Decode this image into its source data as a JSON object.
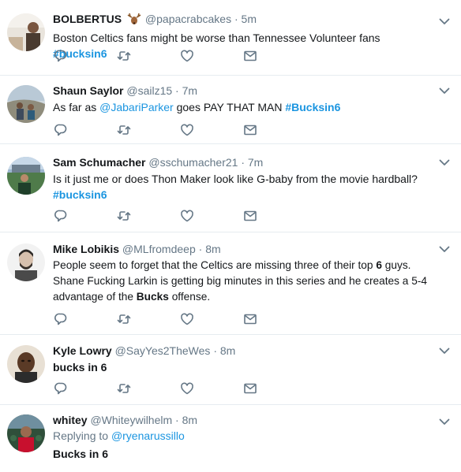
{
  "colors": {
    "link": "#1b95e0",
    "secondary_text": "#657786",
    "icon": "#657786",
    "divider": "#e6ecf0"
  },
  "icons": {
    "reply": "reply-icon",
    "retweet": "retweet-icon",
    "like": "heart-icon",
    "message": "envelope-icon",
    "menu": "chevron-down-icon"
  },
  "tweets": [
    {
      "name": "BOLBERTUS",
      "emoji": "deer-emoji",
      "handle": "@papacrabcakes",
      "dot": "·",
      "time": "5m",
      "text_before": "Boston Celtics fans might be worse than Tennessee Volunteer fans ",
      "hashtag": "#bucksin6"
    },
    {
      "name": "Shaun Saylor",
      "handle": "@sailz15",
      "dot": "·",
      "time": "7m",
      "text_before": "As far as ",
      "mention": "@JabariParker",
      "text_middle": " goes PAY THAT MAN ",
      "hashtag": "#Bucksin6"
    },
    {
      "name": "Sam Schumacher",
      "handle": "@sschumacher21",
      "dot": "·",
      "time": "7m",
      "text_before": "Is it just me or does Thon Maker look like G-baby from the movie hardball?",
      "hashtag": "#bucksin6"
    },
    {
      "name": "Mike Lobikis",
      "handle": "@MLfromdeep",
      "dot": "·",
      "time": "8m",
      "text_before": "People seem to forget that the Celtics are missing three of their top ",
      "bold_1": "6",
      "text_middle": " guys. Shane Fucking Larkin is getting big minutes in this series and he creates a 5-4 advantage of the ",
      "bold_2": "Bucks",
      "text_after": " offense."
    },
    {
      "name": "Kyle Lowry",
      "handle": "@SayYes2TheWes",
      "dot": "·",
      "time": "8m",
      "text_bold": "bucks in 6"
    },
    {
      "name": "whitey",
      "handle": "@Whiteywilhelm",
      "dot": "·",
      "time": "8m",
      "replying_label": "Replying to ",
      "replying_mention": "@ryenarussillo",
      "text_bold": "Bucks in 6"
    }
  ]
}
